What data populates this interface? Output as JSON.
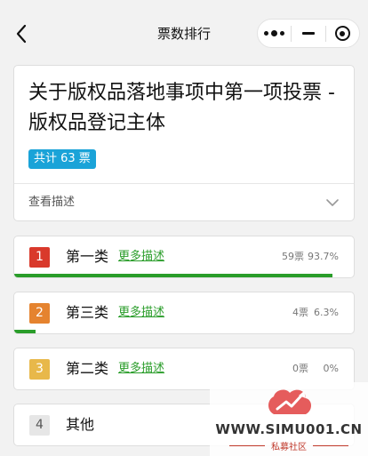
{
  "navbar": {
    "title": "票数排行",
    "back_icon": "chevron-left-icon",
    "capsule": {
      "more_icon": "more-dots-icon",
      "minimize_icon": "minimize-icon",
      "close_icon": "target-close-icon"
    }
  },
  "header": {
    "title": "关于版权品落地事项中第一项投票 - 版权品登记主体",
    "total_votes": "共计 63 票",
    "badge_color": "#1aa3d8",
    "view_description": "查看描述",
    "expand_icon": "chevron-down-icon"
  },
  "options": [
    {
      "rank": "1",
      "name": "第一类",
      "more": "更多描述",
      "votes": "59票",
      "percent": "93.7%",
      "ratio": 0.937,
      "rank_color": "#d9392b"
    },
    {
      "rank": "2",
      "name": "第三类",
      "more": "更多描述",
      "votes": "4票",
      "percent": "6.3%",
      "ratio": 0.063,
      "rank_color": "#e5832f"
    },
    {
      "rank": "3",
      "name": "第二类",
      "more": "更多描述",
      "votes": "0票",
      "percent": "0%",
      "ratio": 0,
      "rank_color": "#e8b84a"
    },
    {
      "rank": "4",
      "name": "其他",
      "more": "",
      "votes": "",
      "percent": "",
      "ratio": 0,
      "rank_color": "#e6e6e6"
    }
  ],
  "colors": {
    "accent_green": "#2a9d2a",
    "background": "#f2f2f2"
  },
  "watermark": {
    "text": "WWW.SIMU001.CN",
    "subtext": "私募社区"
  }
}
